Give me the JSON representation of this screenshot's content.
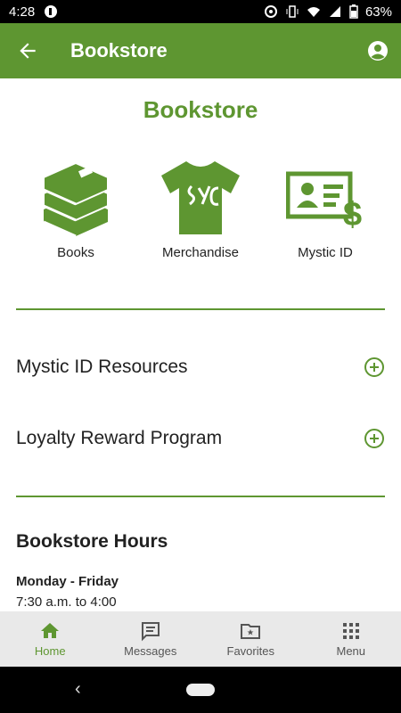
{
  "status_bar": {
    "time": "4:28",
    "battery": "63%"
  },
  "app_bar": {
    "title": "Bookstore"
  },
  "page": {
    "title": "Bookstore"
  },
  "tiles": [
    {
      "label": "Books"
    },
    {
      "label": "Merchandise"
    },
    {
      "label": "Mystic ID"
    }
  ],
  "rows": [
    {
      "label": "Mystic ID Resources"
    },
    {
      "label": "Loyalty Reward Program"
    }
  ],
  "hours": {
    "title": "Bookstore Hours",
    "day": "Monday - Friday",
    "time": "7:30 a.m. to 4:00"
  },
  "bottom_nav": [
    {
      "label": "Home",
      "icon": "home-icon",
      "active": true
    },
    {
      "label": "Messages",
      "icon": "message-icon",
      "active": false
    },
    {
      "label": "Favorites",
      "icon": "favorites-folder-icon",
      "active": false
    },
    {
      "label": "Menu",
      "icon": "grid-menu-icon",
      "active": false
    }
  ],
  "colors": {
    "accent": "#5e9631",
    "nav_bg": "#e9e9e9"
  }
}
